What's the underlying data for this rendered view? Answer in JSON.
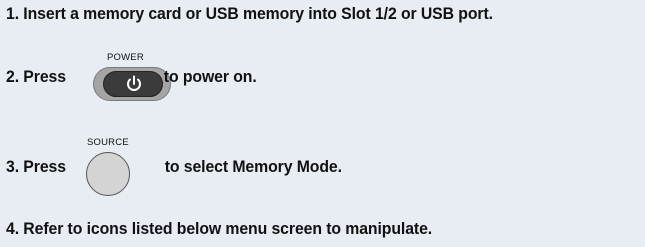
{
  "steps": [
    {
      "number": "1.",
      "text": "Insert a memory card or USB memory into Slot 1/2 or USB port."
    },
    {
      "number": "2.",
      "before": "Press",
      "after": "to power on.",
      "button_caption": "POWER",
      "button_icon": "power-icon"
    },
    {
      "number": "3.",
      "before": "Press",
      "after": "to select Memory Mode.",
      "button_caption": "SOURCE",
      "button_icon": "round-button"
    },
    {
      "number": "4.",
      "text": "Refer to icons listed below menu screen to manipulate."
    }
  ],
  "colors": {
    "background": "#e8ecf3",
    "text": "#111111",
    "power_button_outer": "#a5a5a5",
    "power_button_inner": "#3b3b3b",
    "source_button": "#d4d4d4"
  }
}
